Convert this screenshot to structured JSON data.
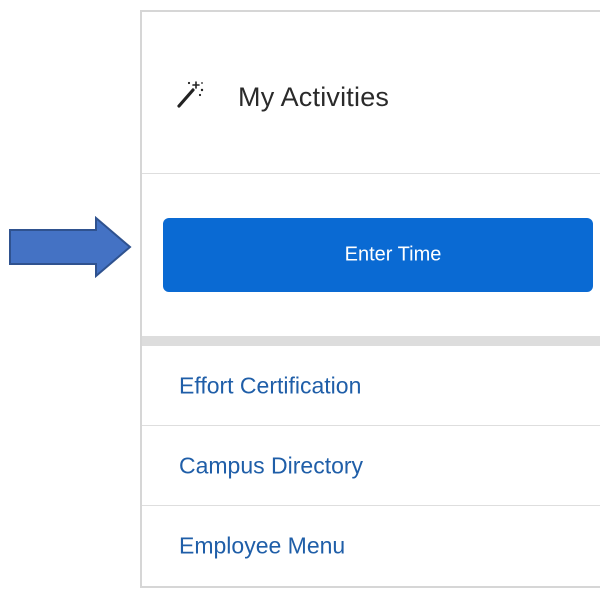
{
  "card": {
    "title": "My Activities",
    "title_icon": "magic-wand-icon"
  },
  "primary_action": {
    "label": "Enter Time"
  },
  "links": [
    {
      "label": "Effort Certification"
    },
    {
      "label": "Campus Directory"
    },
    {
      "label": "Employee Menu"
    }
  ],
  "colors": {
    "button_bg": "#0a6ad3",
    "button_text": "#ffffff",
    "link_text": "#1f5ea8",
    "title_text": "#2a2a2a",
    "arrow_fill": "#4472c4",
    "arrow_stroke": "#2f528f",
    "card_border": "#d6d6d6",
    "separator": "#dddddd"
  },
  "annotation": {
    "icon": "right-arrow-icon"
  }
}
